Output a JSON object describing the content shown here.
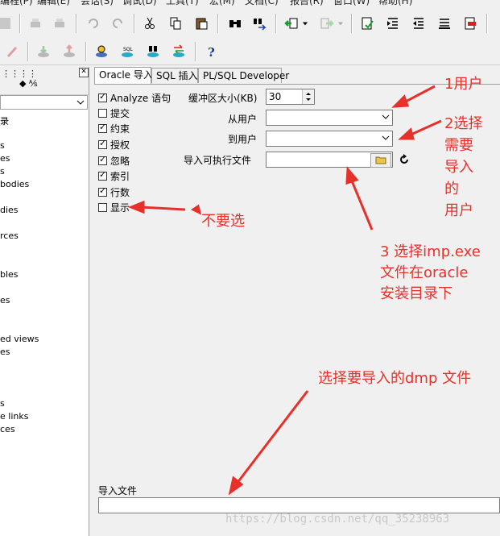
{
  "menu": {
    "items": [
      "编程(P)",
      "编辑(E)",
      "会话(S)",
      "调试(D)",
      "工具(T)",
      "宏(M)",
      "文档(C)",
      "报告(R)",
      "窗口(W)",
      "帮助(H)"
    ]
  },
  "left_panel": {
    "tree_items": [
      "",
      "录",
      "s",
      "es",
      "s",
      "bodies",
      "dies",
      "rces",
      "bles",
      "es",
      "ed views",
      "es",
      "s",
      "e links",
      "ces"
    ]
  },
  "tabs": [
    "Oracle 导入",
    "SQL 插入",
    "PL/SQL Developer"
  ],
  "options": {
    "analyze": {
      "label": "Analyze 语句",
      "checked": true
    },
    "commit": {
      "label": "提交",
      "checked": false
    },
    "constraints": {
      "label": "约束",
      "checked": true
    },
    "grants": {
      "label": "授权",
      "checked": true
    },
    "ignore": {
      "label": "忽略",
      "checked": true
    },
    "indexes": {
      "label": "索引",
      "checked": true
    },
    "rows": {
      "label": "行数",
      "checked": true
    },
    "show": {
      "label": "显示",
      "checked": false
    }
  },
  "fields": {
    "buffer_label": "缓冲区大小(KB)",
    "buffer_value": "30",
    "from_user_label": "从用户",
    "from_user_value": "",
    "to_user_label": "到用户",
    "to_user_value": "",
    "exe_label": "导入可执行文件",
    "exe_value": ""
  },
  "bottom": {
    "import_file_label": "导入文件",
    "import_file_value": ""
  },
  "annotations": {
    "a1": "1用户",
    "a2": "2选择\n需要\n导入\n的\n用户",
    "a3": "不要选",
    "a4": "3 选择imp.exe\n文件在oracle\n安装目录下",
    "a5": "选择要导入的dmp 文件"
  },
  "watermark": "https://blog.csdn.net/qq_35238963",
  "colors": {
    "annotation": "#e8302a"
  }
}
